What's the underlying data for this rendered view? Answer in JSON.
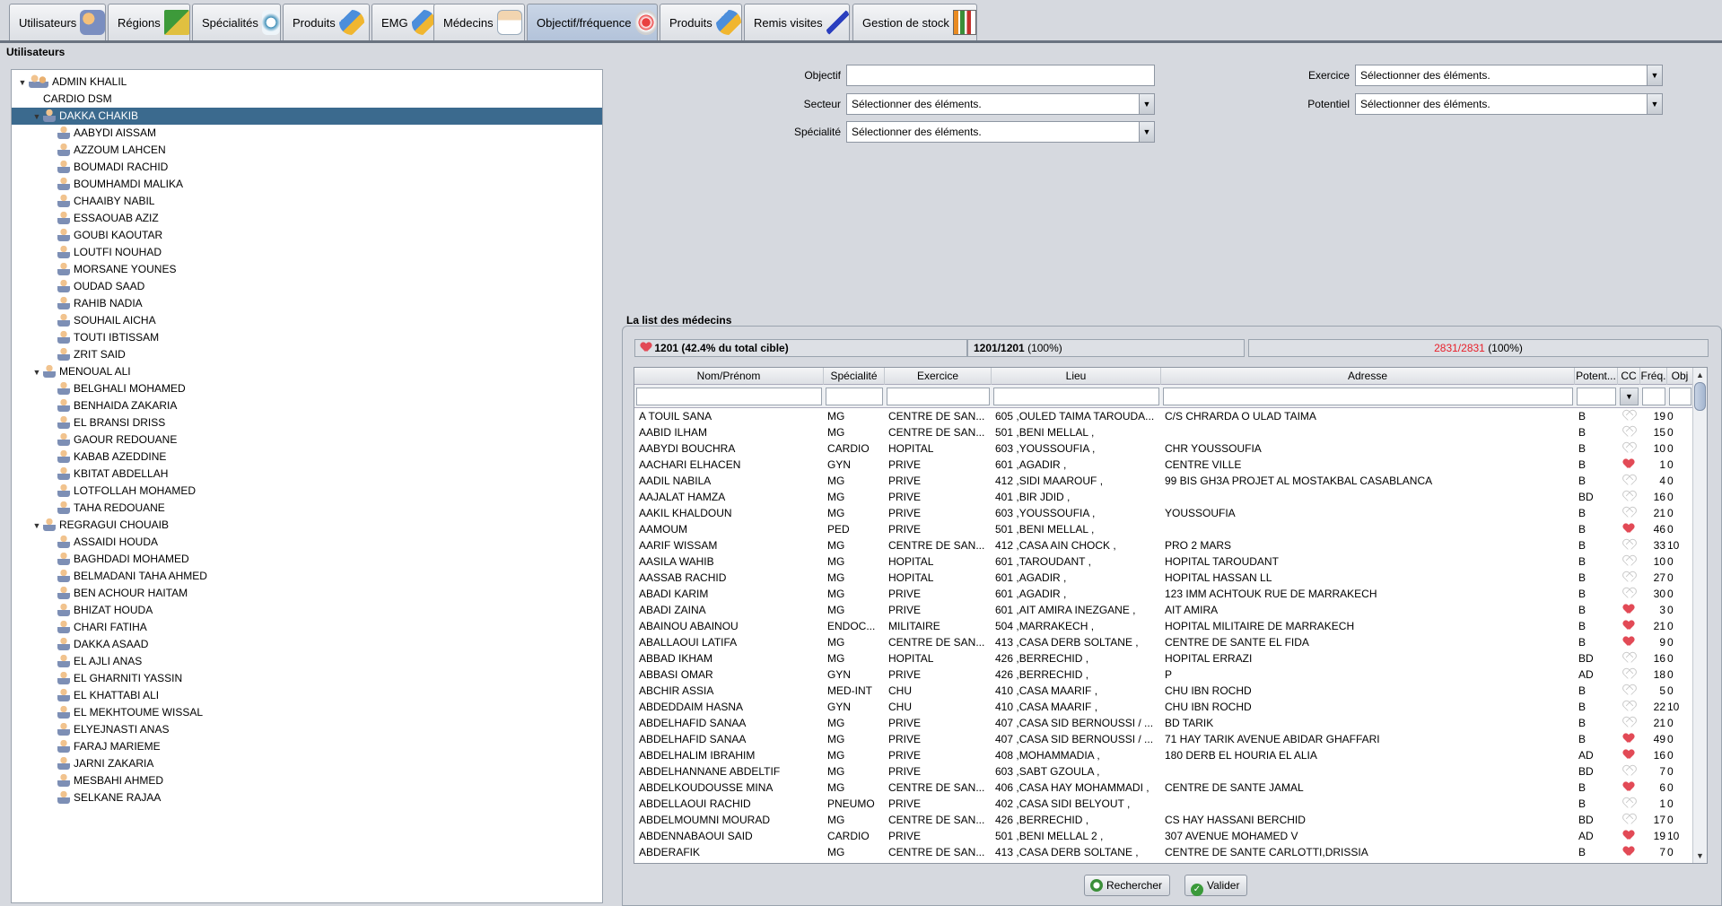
{
  "tabs": [
    {
      "label": "Utilisateurs",
      "icon": "users-icon"
    },
    {
      "label": "Régions",
      "icon": "map-icon"
    },
    {
      "label": "Spécialités",
      "icon": "stethoscope-icon"
    },
    {
      "label": "Produits",
      "icon": "pill-icon"
    },
    {
      "label": "EMG",
      "icon": "pill-icon"
    },
    {
      "label": "Médecins",
      "icon": "doctor-icon"
    },
    {
      "label": "Objectif/fréquence",
      "icon": "target-icon"
    },
    {
      "label": "Produits",
      "icon": "pill-icon"
    },
    {
      "label": "Remis visites",
      "icon": "syringe-icon"
    },
    {
      "label": "Gestion de stock",
      "icon": "stock-chart-icon"
    }
  ],
  "active_tab": "Objectif/fréquence",
  "left_panel": {
    "title": "Utilisateurs",
    "tree": [
      {
        "label": "ADMIN KHALIL",
        "level": 0,
        "expandable": true,
        "icon": "group"
      },
      {
        "label": "CARDIO DSM",
        "level": 1,
        "expandable": false,
        "icon": "none"
      },
      {
        "label": "DAKKA CHAKIB",
        "level": 1,
        "expandable": true,
        "icon": "user",
        "selected": true
      },
      {
        "label": "AABYDI AISSAM",
        "level": 2,
        "icon": "user"
      },
      {
        "label": "AZZOUM LAHCEN",
        "level": 2,
        "icon": "user"
      },
      {
        "label": "BOUMADI RACHID",
        "level": 2,
        "icon": "user"
      },
      {
        "label": "BOUMHAMDI MALIKA",
        "level": 2,
        "icon": "user"
      },
      {
        "label": "CHAAIBY NABIL",
        "level": 2,
        "icon": "user"
      },
      {
        "label": "ESSAOUAB AZIZ",
        "level": 2,
        "icon": "user"
      },
      {
        "label": "GOUBI KAOUTAR",
        "level": 2,
        "icon": "user"
      },
      {
        "label": "LOUTFI  NOUHAD",
        "level": 2,
        "icon": "user"
      },
      {
        "label": "MORSANE YOUNES",
        "level": 2,
        "icon": "user"
      },
      {
        "label": "OUDAD SAAD",
        "level": 2,
        "icon": "user"
      },
      {
        "label": "RAHIB NADIA",
        "level": 2,
        "icon": "user"
      },
      {
        "label": "SOUHAIL AICHA",
        "level": 2,
        "icon": "user"
      },
      {
        "label": "TOUTI IBTISSAM",
        "level": 2,
        "icon": "user"
      },
      {
        "label": "ZRIT SAID",
        "level": 2,
        "icon": "user"
      },
      {
        "label": "MENOUAL ALI",
        "level": 1,
        "expandable": true,
        "icon": "user"
      },
      {
        "label": "BELGHALI MOHAMED",
        "level": 2,
        "icon": "user"
      },
      {
        "label": "BENHAIDA ZAKARIA",
        "level": 2,
        "icon": "user"
      },
      {
        "label": "EL BRANSI DRISS",
        "level": 2,
        "icon": "user"
      },
      {
        "label": "GAOUR REDOUANE",
        "level": 2,
        "icon": "user"
      },
      {
        "label": "KABAB AZEDDINE",
        "level": 2,
        "icon": "user"
      },
      {
        "label": "KBITAT ABDELLAH",
        "level": 2,
        "icon": "user"
      },
      {
        "label": "LOTFOLLAH MOHAMED",
        "level": 2,
        "icon": "user"
      },
      {
        "label": "TAHA REDOUANE",
        "level": 2,
        "icon": "user"
      },
      {
        "label": "REGRAGUI CHOUAIB",
        "level": 1,
        "expandable": true,
        "icon": "user"
      },
      {
        "label": "ASSAIDI HOUDA",
        "level": 2,
        "icon": "user"
      },
      {
        "label": "BAGHDADI MOHAMED",
        "level": 2,
        "icon": "user"
      },
      {
        "label": "BELMADANI TAHA AHMED",
        "level": 2,
        "icon": "user"
      },
      {
        "label": "BEN ACHOUR HAITAM",
        "level": 2,
        "icon": "user"
      },
      {
        "label": "BHIZAT HOUDA",
        "level": 2,
        "icon": "user"
      },
      {
        "label": "CHARI FATIHA",
        "level": 2,
        "icon": "user"
      },
      {
        "label": "DAKKA ASAAD",
        "level": 2,
        "icon": "user"
      },
      {
        "label": "EL AJLI  ANAS",
        "level": 2,
        "icon": "user"
      },
      {
        "label": "EL GHARNITI YASSIN",
        "level": 2,
        "icon": "user"
      },
      {
        "label": "EL KHATTABI ALI",
        "level": 2,
        "icon": "user"
      },
      {
        "label": "EL MEKHTOUME WISSAL",
        "level": 2,
        "icon": "user"
      },
      {
        "label": "ELYEJNASTI ANAS",
        "level": 2,
        "icon": "user"
      },
      {
        "label": "FARAJ MARIEME",
        "level": 2,
        "icon": "user"
      },
      {
        "label": "JARNI ZAKARIA",
        "level": 2,
        "icon": "user"
      },
      {
        "label": "MESBAHI AHMED",
        "level": 2,
        "icon": "user"
      },
      {
        "label": "SELKANE RAJAA",
        "level": 2,
        "icon": "user"
      }
    ]
  },
  "filters": {
    "objectif_label": "Objectif",
    "objectif_value": "",
    "secteur_label": "Secteur",
    "secteur_value": "Sélectionner des éléments.",
    "specialite_label": "Spécialité",
    "specialite_value": "Sélectionner des éléments.",
    "exercice_label": "Exercice",
    "exercice_value": "Sélectionner des éléments.",
    "potentiel_label": "Potentiel",
    "potentiel_value": "Sélectionner des éléments."
  },
  "list": {
    "title": "La list des médecins",
    "stat1": "1201 (42.4% du total cible)",
    "stat2_bold": "1201/1201",
    "stat2_rest": "(100%)",
    "stat3_red": "2831/2831",
    "stat3_rest": "(100%)",
    "colors": {
      "accent_red": "#e8202a",
      "heart": "#e24a56",
      "selection": "#3b6a8e"
    },
    "columns": [
      "Nom/Prénom",
      "Spécialité",
      "Exercice",
      "Lieu",
      "Adresse",
      "Potent...",
      "CC",
      "Fréq.",
      "Obj"
    ],
    "rows": [
      [
        "A TOUIL SANA",
        "MG",
        "CENTRE DE SAN...",
        "605 ,OULED TAIMA TAROUDA...",
        "C/S CHRARDA O ULAD TAIMA",
        "B",
        "empty",
        "19",
        "0"
      ],
      [
        "AABID ILHAM",
        "MG",
        "CENTRE DE SAN...",
        "501 ,BENI MELLAL ,",
        "",
        "B",
        "empty",
        "15",
        "0"
      ],
      [
        "AABYDI BOUCHRA",
        "CARDIO",
        "HOPITAL",
        "603 ,YOUSSOUFIA ,",
        "CHR YOUSSOUFIA",
        "B",
        "empty",
        "10",
        "0"
      ],
      [
        "AACHARI ELHACEN",
        "GYN",
        "PRIVE",
        "601 ,AGADIR ,",
        "CENTRE VILLE",
        "B",
        "full",
        "1",
        "0"
      ],
      [
        "AADIL NABILA",
        "MG",
        "PRIVE",
        "412 ,SIDI MAAROUF ,",
        "99 BIS GH3A PROJET AL MOSTAKBAL CASABLANCA",
        "B",
        "empty",
        "4",
        "0"
      ],
      [
        "AAJALAT HAMZA",
        "MG",
        "PRIVE",
        "401 ,BIR JDID ,",
        "",
        "BD",
        "empty",
        "16",
        "0"
      ],
      [
        "AAKIL KHALDOUN",
        "MG",
        "PRIVE",
        "603 ,YOUSSOUFIA ,",
        "YOUSSOUFIA",
        "B",
        "empty",
        "21",
        "0"
      ],
      [
        "AAMOUM",
        "PED",
        "PRIVE",
        "501 ,BENI MELLAL ,",
        "",
        "B",
        "full",
        "46",
        "0"
      ],
      [
        "AARIF WISSAM",
        "MG",
        "CENTRE DE SAN...",
        "412 ,CASA AIN CHOCK ,",
        "PRO 2 MARS",
        "B",
        "empty",
        "33",
        "10"
      ],
      [
        "AASILA WAHIB",
        "MG",
        "HOPITAL",
        "601 ,TAROUDANT ,",
        "HOPITAL TAROUDANT",
        "B",
        "empty",
        "10",
        "0"
      ],
      [
        "AASSAB RACHID",
        "MG",
        "HOPITAL",
        "601 ,AGADIR ,",
        "HOPITAL HASSAN LL",
        "B",
        "empty",
        "27",
        "0"
      ],
      [
        "ABADI KARIM",
        "MG",
        "PRIVE",
        "601 ,AGADIR ,",
        "123 IMM ACHTOUK RUE DE MARRAKECH",
        "B",
        "empty",
        "30",
        "0"
      ],
      [
        "ABADI ZAINA",
        "MG",
        "PRIVE",
        "601 ,AIT AMIRA INEZGANE ,",
        "AIT AMIRA",
        "B",
        "full",
        "3",
        "0"
      ],
      [
        "ABAINOU ABAINOU",
        "ENDOC...",
        "MILITAIRE",
        "504 ,MARRAKECH ,",
        "HOPITAL MILITAIRE DE MARRAKECH",
        "B",
        "full",
        "21",
        "0"
      ],
      [
        "ABALLAOUI LATIFA",
        "MG",
        "CENTRE DE SAN...",
        "413 ,CASA DERB SOLTANE ,",
        "CENTRE DE SANTE EL FIDA",
        "B",
        "full",
        "9",
        "0"
      ],
      [
        "ABBAD IKHAM",
        "MG",
        "HOPITAL",
        "426 ,BERRECHID ,",
        "HOPITAL ERRAZI",
        "BD",
        "empty",
        "16",
        "0"
      ],
      [
        "ABBASI OMAR",
        "GYN",
        "PRIVE",
        "426 ,BERRECHID ,",
        "P",
        "AD",
        "empty",
        "18",
        "0"
      ],
      [
        "ABCHIR ASSIA",
        "MED-INT",
        "CHU",
        "410 ,CASA MAARIF ,",
        "CHU  IBN ROCHD",
        "B",
        "empty",
        "5",
        "0"
      ],
      [
        "ABDEDDAIM HASNA",
        "GYN",
        "CHU",
        "410 ,CASA MAARIF ,",
        "CHU IBN ROCHD",
        "B",
        "empty",
        "22",
        "10"
      ],
      [
        "ABDELHAFID SANAA",
        "MG",
        "PRIVE",
        "407 ,CASA SID BERNOUSSI / ...",
        "BD TARIK",
        "B",
        "empty",
        "21",
        "0"
      ],
      [
        "ABDELHAFID SANAA",
        "MG",
        "PRIVE",
        "407 ,CASA SID BERNOUSSI / ...",
        "71 HAY TARIK AVENUE ABIDAR GHAFFARI",
        "B",
        "full",
        "49",
        "0"
      ],
      [
        "ABDELHALIM IBRAHIM",
        "MG",
        "PRIVE",
        "408 ,MOHAMMADIA ,",
        "180 DERB EL HOURIA EL ALIA",
        "AD",
        "full",
        "16",
        "0"
      ],
      [
        "ABDELHANNANE ABDELTIF",
        "MG",
        "PRIVE",
        "603 ,SABT GZOULA ,",
        "",
        "BD",
        "empty",
        "7",
        "0"
      ],
      [
        "ABDELKOUDOUSSE MINA",
        "MG",
        "CENTRE DE SAN...",
        "406 ,CASA HAY MOHAMMADI ,",
        "CENTRE DE SANTE JAMAL",
        "B",
        "full",
        "6",
        "0"
      ],
      [
        "ABDELLAOUI RACHID",
        "PNEUMO",
        "PRIVE",
        "402 ,CASA SIDI BELYOUT ,",
        "",
        "B",
        "empty",
        "1",
        "0"
      ],
      [
        "ABDELMOUMNI MOURAD",
        "MG",
        "CENTRE DE SAN...",
        "426 ,BERRECHID ,",
        "CS HAY HASSANI BERCHID",
        "BD",
        "empty",
        "17",
        "0"
      ],
      [
        "ABDENNABAOUI SAID",
        "CARDIO",
        "PRIVE",
        "501 ,BENI MELLAL 2 ,",
        "307 AVENUE MOHAMED V",
        "AD",
        "full",
        "19",
        "10"
      ],
      [
        "ABDERAFIK",
        "MG",
        "CENTRE DE SAN...",
        "413 ,CASA DERB SOLTANE ,",
        "CENTRE DE SANTE CARLOTTI,DRISSIA",
        "B",
        "full",
        "7",
        "0"
      ]
    ]
  },
  "buttons": {
    "search": "Rechercher",
    "validate": "Valider"
  }
}
